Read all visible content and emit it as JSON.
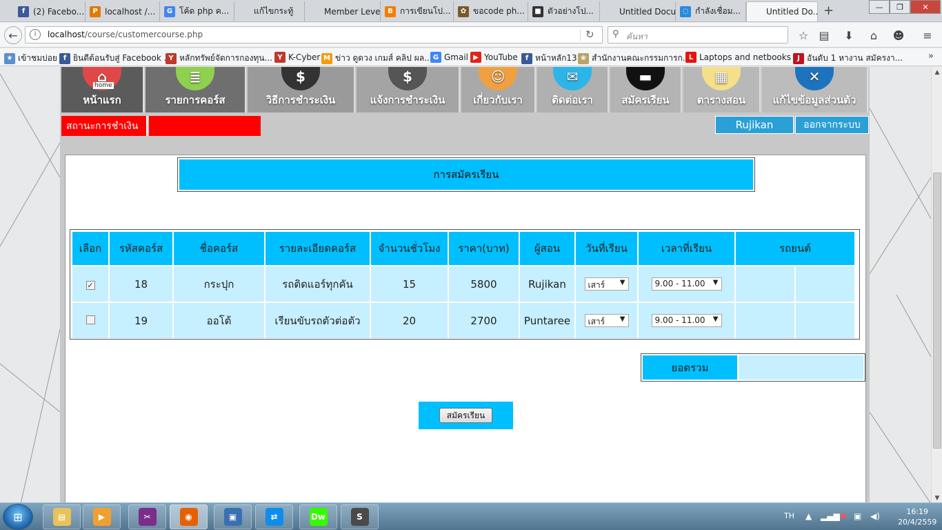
{
  "browser": {
    "tabs": [
      {
        "title": "(2) Facebo...",
        "icon": "facebook-icon",
        "color": "#3b5998",
        "glyph": "f"
      },
      {
        "title": "localhost /...",
        "icon": "phpmyadmin-icon",
        "color": "#e07b00",
        "glyph": "P"
      },
      {
        "title": "โค้ด php ค...",
        "icon": "google-icon",
        "color": "#4285f4",
        "glyph": "G"
      },
      {
        "title": "แก้ไขกระทู้",
        "icon": "blank-page-icon",
        "color": "#d4d7dc",
        "glyph": ""
      },
      {
        "title": "Member Level",
        "icon": "blank-page-icon",
        "color": "#d4d7dc",
        "glyph": ""
      },
      {
        "title": "การเขียนโป...",
        "icon": "blogger-icon",
        "color": "#f57d00",
        "glyph": "B"
      },
      {
        "title": "ขอcode ph...",
        "icon": "people-icon",
        "color": "#7a5a2a",
        "glyph": "✿"
      },
      {
        "title": "ตัวอย่างโป...",
        "icon": "avatar-icon",
        "color": "#333333",
        "glyph": "■"
      },
      {
        "title": "Untitled Docu...",
        "icon": "blank-page-icon",
        "color": "#d4d7dc",
        "glyph": ""
      },
      {
        "title": "กำลังเชื่อม...",
        "icon": "loading-spinner-icon",
        "color": "#2a8be0",
        "glyph": "◌"
      },
      {
        "title": "Untitled Do...",
        "icon": "blank-page-icon",
        "color": "#f5f6f7",
        "glyph": ""
      }
    ],
    "active_tab": 10,
    "new_tab_glyph": "+",
    "url_host": "localhost",
    "url_path": "/course/customercourse.php",
    "search_placeholder": "ค้นหา",
    "bookmarks": [
      {
        "label": "เข้าชมบ่อย",
        "icon": "star-folder-icon",
        "color": "#5a8fd0",
        "glyph": "★"
      },
      {
        "label": "ยินดีต้อนรับสู่ Facebook ...",
        "icon": "facebook-icon",
        "color": "#3b5998",
        "glyph": "f"
      },
      {
        "label": "หลักทรัพย์จัดการกองทุน...",
        "icon": "kbank-icon",
        "color": "#c0392b",
        "glyph": "Y"
      },
      {
        "label": "K-Cyber",
        "icon": "kbank-icon",
        "color": "#c0392b",
        "glyph": "Y"
      },
      {
        "label": "ข่าว ดูดวง เกมส์ คลิป ผล...",
        "icon": "m-logo-icon",
        "color": "#f39c12",
        "glyph": "M"
      },
      {
        "label": "Gmail",
        "icon": "google-icon",
        "color": "#4285f4",
        "glyph": "G"
      },
      {
        "label": "YouTube",
        "icon": "youtube-icon",
        "color": "#e62117",
        "glyph": "▶"
      },
      {
        "label": "หน้าหลัก13",
        "icon": "facebook-icon",
        "color": "#3b5998",
        "glyph": "f"
      },
      {
        "label": "สำนักงานคณะกรรมการก...",
        "icon": "seal-icon",
        "color": "#b8a26a",
        "glyph": "❀"
      },
      {
        "label": "Laptops and netbooks ...",
        "icon": "l-logo-icon",
        "color": "#e8140c",
        "glyph": "L"
      },
      {
        "label": "อันดับ 1 หางาน สมัครงา...",
        "icon": "jobth-icon",
        "color": "#c0121f",
        "glyph": "J"
      }
    ]
  },
  "menu": [
    {
      "label": "หน้าแรก",
      "icon": "home-icon",
      "glyph": "⌂",
      "bg": "#5b5b5b",
      "icon_bg": "#e04848"
    },
    {
      "label": "รายการคอร์ส",
      "icon": "notepad-icon",
      "glyph": "≣",
      "bg": "#6f6f6f",
      "icon_bg": "#8fd14f"
    },
    {
      "label": "วิธีการชำระเงิน",
      "icon": "mobile-payment-icon",
      "glyph": "$",
      "bg": "#9a9a9a",
      "icon_bg": "#333333"
    },
    {
      "label": "แจ้งการชำระเงิน",
      "icon": "money-icon",
      "glyph": "$",
      "bg": "#a4a4a4",
      "icon_bg": "#555555"
    },
    {
      "label": "เกี่ยวกับเรา",
      "icon": "person-icon",
      "glyph": "☺",
      "bg": "#a9a9a9",
      "icon_bg": "#f0a040"
    },
    {
      "label": "ติดต่อเรา",
      "icon": "envelope-icon",
      "glyph": "✉",
      "bg": "#b0b0b0",
      "icon_bg": "#2cb5e8"
    },
    {
      "label": "สมัครเรียน",
      "icon": "car-icon",
      "glyph": "▬",
      "bg": "#b4b4b4",
      "icon_bg": "#111111"
    },
    {
      "label": "ตารางสอน",
      "icon": "timetable-icon",
      "glyph": "▦",
      "bg": "#b8b8b8",
      "icon_bg": "#f5e08a"
    },
    {
      "label": "แก้ไขข้อมูลส่วนตัว",
      "icon": "tools-icon",
      "glyph": "✕",
      "bg": "#bcbcbc",
      "icon_bg": "#1e73be"
    }
  ],
  "home_icon_caption": "home",
  "payment_status_label": "สถานะการชำเงิน",
  "payment_status_value": "",
  "username": "Rujikan",
  "logout_label": "ออกจากระบบ",
  "form_title": "การสมัครเรียน",
  "table": {
    "headers": [
      "เลือก",
      "รหัสคอร์ส",
      "ชื่อคอร์ส",
      "รายละเอียดคอร์ส",
      "จำนวนชั่วโมง",
      "ราคา(บาท)",
      "ผู้สอน",
      "วันที่เรียน",
      "เวลาที่เรียน",
      "รถยนต์"
    ],
    "rows": [
      {
        "checked": true,
        "code": "18",
        "name": "กระปุก",
        "detail": "รถติดแอร์ทุกคัน",
        "hours": "15",
        "price": "5800",
        "teacher": "Rujikan",
        "day": "เสาร์",
        "time": "9.00 - 11.00"
      },
      {
        "checked": false,
        "code": "19",
        "name": "ออโต้",
        "detail": "เรียนขับรถตัวต่อตัว",
        "hours": "20",
        "price": "2700",
        "teacher": "Puntaree",
        "day": "เสาร์",
        "time": "9.00 - 11.00"
      }
    ]
  },
  "total_label": "ยอดรวม",
  "total_value": "",
  "submit_label": "สมัครเรียน",
  "taskbar": {
    "apps": [
      {
        "name": "explorer",
        "icon": "folder-icon",
        "color": "#e8c25a",
        "glyph": "▤"
      },
      {
        "name": "media-player",
        "icon": "media-player-icon",
        "color": "#f0a030",
        "glyph": "▶"
      },
      {
        "name": "video-editor",
        "icon": "clapper-icon",
        "color": "#7a2e8a",
        "glyph": "✂"
      },
      {
        "name": "firefox",
        "icon": "firefox-icon",
        "color": "#e66000",
        "glyph": "◉"
      },
      {
        "name": "remote-desktop",
        "icon": "network-computer-icon",
        "color": "#3a6fb0",
        "glyph": "▣"
      },
      {
        "name": "teamviewer",
        "icon": "teamviewer-icon",
        "color": "#0e8ee9",
        "glyph": "⇄"
      },
      {
        "name": "dreamweaver",
        "icon": "dreamweaver-icon",
        "color": "#35fa00",
        "glyph": "Dw"
      },
      {
        "name": "sublime-text",
        "icon": "sublime-icon",
        "color": "#4a4a4a",
        "glyph": "S"
      }
    ],
    "active_app": 3,
    "lang": "TH",
    "time": "16:19",
    "date": "20/4/2559"
  }
}
